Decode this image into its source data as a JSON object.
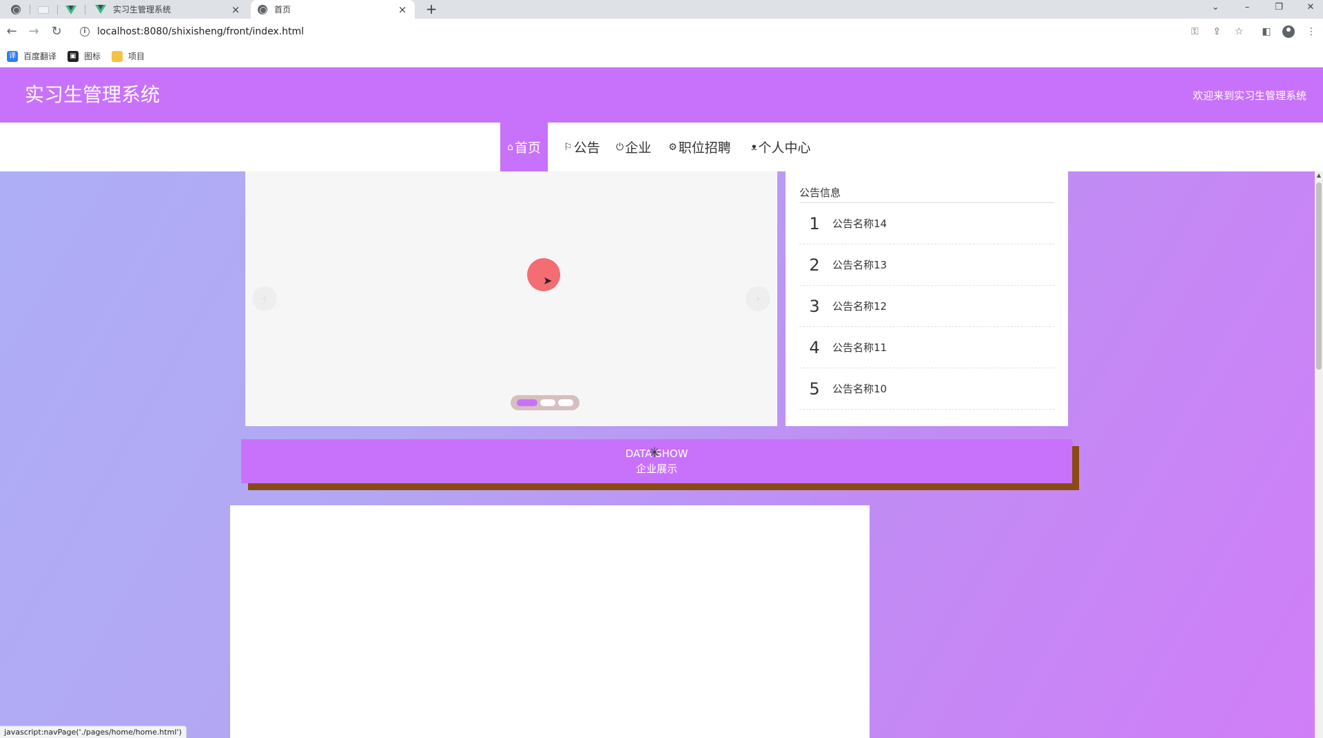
{
  "browser": {
    "tabs": [
      {
        "title": "实习生管理系统",
        "close": "×"
      },
      {
        "title": "首页",
        "close": "×"
      }
    ],
    "new_tab": "+",
    "window_controls": {
      "chevron": "⌄",
      "minimize": "–",
      "restore": "❐",
      "close": "✕"
    },
    "nav": {
      "back": "←",
      "forward": "→",
      "reload": "↻"
    },
    "url": "localhost:8080/shixisheng/front/index.html",
    "bookmarks": [
      {
        "label": "百度翻译",
        "icon": "translate-icon",
        "color": "#2f7df6"
      },
      {
        "label": "图标",
        "icon": "image-icon",
        "color": "#222222"
      },
      {
        "label": "项目",
        "icon": "folder-icon",
        "color": "#f5c244"
      }
    ],
    "status_url": "javascript:navPage('./pages/home/home.html')"
  },
  "site": {
    "title": "实习生管理系统",
    "welcome": "欢迎来到实习生管理系统",
    "accent": "#c872fc",
    "menu": [
      {
        "label": "首页",
        "icon": "home-icon",
        "glyph": "⌂",
        "active": true
      },
      {
        "label": "公告",
        "icon": "flag-icon",
        "glyph": "⚐",
        "active": false
      },
      {
        "label": "企业",
        "icon": "power-icon",
        "glyph": "⏻",
        "active": false
      },
      {
        "label": "职位招聘",
        "icon": "gear-icon",
        "glyph": "⚙",
        "active": false
      },
      {
        "label": "个人中心",
        "icon": "user-icon",
        "glyph": "ᴥ",
        "active": false
      }
    ]
  },
  "carousel": {
    "prev": "‹",
    "next": "›",
    "indicator_count": 3,
    "active_index": 0
  },
  "notice": {
    "title": "公告信息",
    "items": [
      {
        "num": "1",
        "name": "公告名称14"
      },
      {
        "num": "2",
        "name": "公告名称13"
      },
      {
        "num": "3",
        "name": "公告名称12"
      },
      {
        "num": "4",
        "name": "公告名称11"
      },
      {
        "num": "5",
        "name": "公告名称10"
      }
    ]
  },
  "section": {
    "en": "DATA SHOW",
    "cn": "企业展示"
  }
}
